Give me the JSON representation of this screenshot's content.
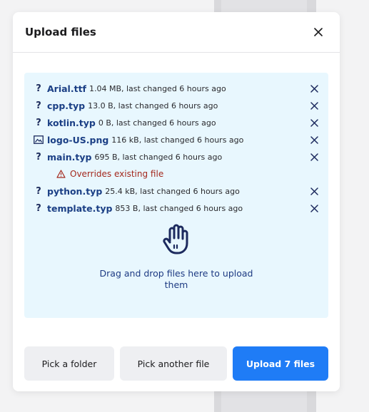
{
  "dialog": {
    "title": "Upload files",
    "close_icon": "close-icon"
  },
  "files": [
    {
      "icon": "unknown-file-icon",
      "glyph": "?",
      "name": "Arial.ttf",
      "meta": "1.04 MB, last changed 6 hours ago"
    },
    {
      "icon": "unknown-file-icon",
      "glyph": "?",
      "name": "cpp.typ",
      "meta": "13.0 B, last changed 6 hours ago"
    },
    {
      "icon": "unknown-file-icon",
      "glyph": "?",
      "name": "kotlin.typ",
      "meta": "0 B, last changed 6 hours ago"
    },
    {
      "icon": "image-file-icon",
      "glyph": "",
      "name": "logo-US.png",
      "meta": "116 kB, last changed 6 hours ago"
    },
    {
      "icon": "unknown-file-icon",
      "glyph": "?",
      "name": "main.typ",
      "meta": "695 B, last changed 6 hours ago",
      "warning": "Overrides existing file"
    },
    {
      "icon": "unknown-file-icon",
      "glyph": "?",
      "name": "python.typ",
      "meta": "25.4 kB, last changed 6 hours ago"
    },
    {
      "icon": "unknown-file-icon",
      "glyph": "?",
      "name": "template.typ",
      "meta": "853 B, last changed 6 hours ago"
    }
  ],
  "dropzone": {
    "icon": "hand-icon",
    "text": "Drag and drop files here to upload them"
  },
  "buttons": {
    "pick_folder": "Pick a folder",
    "pick_file": "Pick another file",
    "upload": "Upload 7 files"
  },
  "colors": {
    "primary": "#1f7cf6",
    "dropzone_bg": "#e8f7fe",
    "warning": "#a3281c",
    "file_name": "#1b3f85"
  }
}
